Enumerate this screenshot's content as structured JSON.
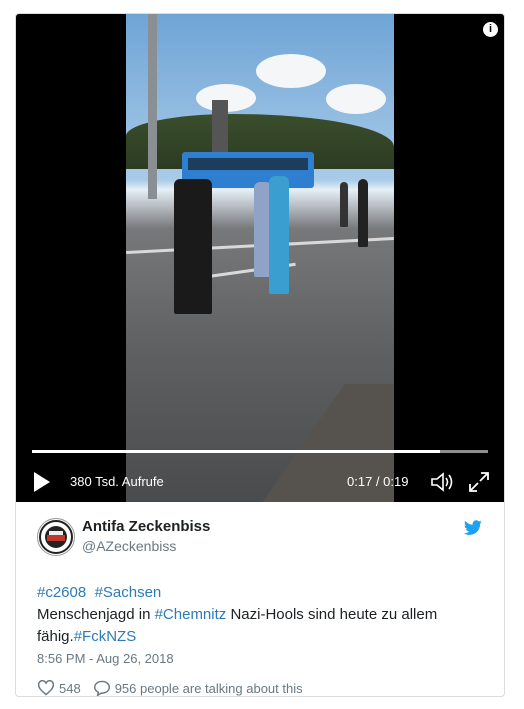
{
  "video": {
    "info_icon": "info-icon",
    "views_label": "380 Tsd. Aufrufe",
    "time_label": "0:17 / 0:19",
    "progress_fraction": 0.894,
    "play_icon": "play-icon",
    "volume_icon": "volume-icon",
    "fullscreen_icon": "fullscreen-icon"
  },
  "author": {
    "name": "Antifa Zeckenbiss",
    "handle": "@AZeckenbiss",
    "bird_icon": "twitter-bird-icon"
  },
  "tweet": {
    "hashtag1": "#c2608",
    "hashtag2": "#Sachsen",
    "text1": "Menschenjagd in ",
    "hashtag3": "#Chemnitz",
    "text2": " Nazi-Hools sind heute zu allem fähig.",
    "hashtag4": "#FckNZS",
    "timestamp": "8:56 PM - Aug 26, 2018"
  },
  "actions": {
    "like_count": "548",
    "talking_label": "956 people are talking about this"
  },
  "colors": {
    "link": "#2b7bb9",
    "secondary_text": "#697882",
    "twitter_blue": "#1da1f2"
  }
}
